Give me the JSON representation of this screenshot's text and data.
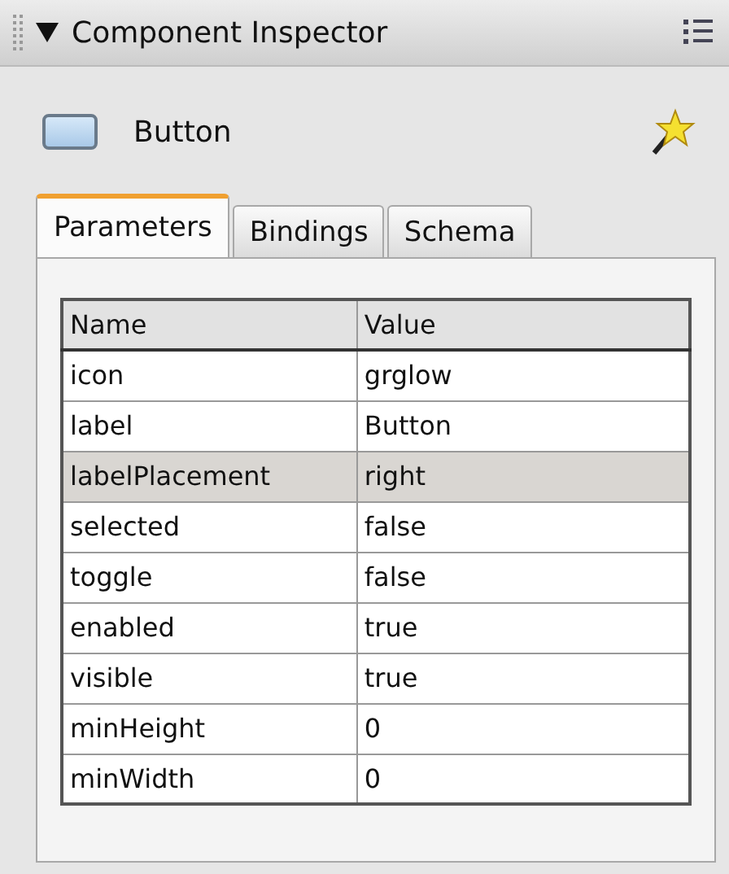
{
  "panel": {
    "title": "Component Inspector",
    "expanded": true
  },
  "component": {
    "name": "Button"
  },
  "tabs": [
    {
      "label": "Parameters",
      "selected": true
    },
    {
      "label": "Bindings",
      "selected": false
    },
    {
      "label": "Schema",
      "selected": false
    }
  ],
  "table": {
    "columns": [
      "Name",
      "Value"
    ],
    "rows": [
      {
        "name": "icon",
        "value": "grglow",
        "selected": false
      },
      {
        "name": "label",
        "value": "Button",
        "selected": false
      },
      {
        "name": "labelPlacement",
        "value": "right",
        "selected": true
      },
      {
        "name": "selected",
        "value": "false",
        "selected": false
      },
      {
        "name": "toggle",
        "value": "false",
        "selected": false
      },
      {
        "name": "enabled",
        "value": "true",
        "selected": false
      },
      {
        "name": "visible",
        "value": "true",
        "selected": false
      },
      {
        "name": "minHeight",
        "value": "0",
        "selected": false
      },
      {
        "name": "minWidth",
        "value": "0",
        "selected": false
      }
    ]
  }
}
